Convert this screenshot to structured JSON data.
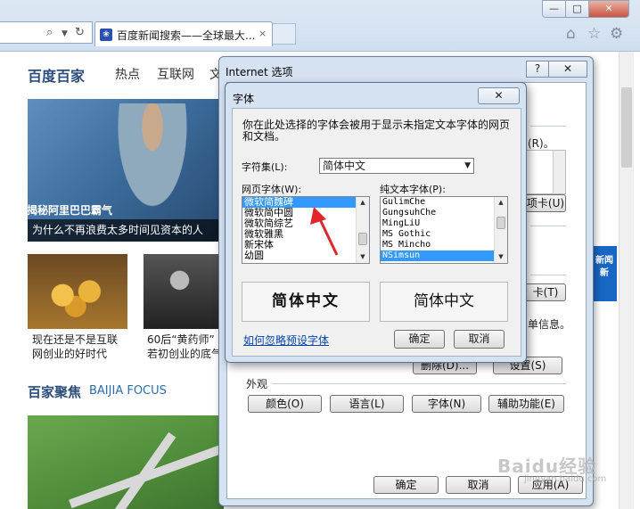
{
  "browser": {
    "tab_title": "百度新闻搜索——全球最大...",
    "tab_close": "×",
    "window_buttons": {
      "minimize": "—",
      "maximize": "□",
      "close": "✕"
    },
    "toolbar_icons": [
      "home-icon",
      "star-icon",
      "gear-icon"
    ]
  },
  "page": {
    "brand": "百度百家",
    "nav": [
      "热点",
      "互联网",
      "文"
    ],
    "hero_overlay_text": "揭秘阿里巴巴霸气",
    "hero_caption": "为什么不再浪费太多时间见资本的人",
    "card1_caption_line1": "现在还是不是互联",
    "card1_caption_line2": "网创业的好时代",
    "card2_caption_line1": "60后“黄药师”",
    "card2_caption_line2": "若初创业的底气",
    "section_title": "百家聚焦",
    "section_subtitle": "BAIJIA FOCUS",
    "ad_text": "新闻 新"
  },
  "internet_options": {
    "title": "Internet 选项",
    "help_label": "?",
    "close_label": "✕",
    "fragment_1": "(R)。",
    "fragment_2": "项卡(U)",
    "fragment_3": "卡(T)",
    "fragment_4": "单信息。",
    "delete_label": "删除(D)...",
    "settings_label": "设置(S)",
    "appearance_label": "外观",
    "colors_label": "颜色(O)",
    "languages_label": "语言(L)",
    "fonts_label": "字体(N)",
    "accessibility_label": "辅助功能(E)",
    "ok_label": "确定",
    "cancel_label": "取消",
    "apply_label": "应用(A)"
  },
  "font_dialog": {
    "title": "字体",
    "close_label": "✕",
    "description": "你在此处选择的字体会被用于显示未指定文本字体的网页和文档。",
    "charset_label": "字符集(L):",
    "charset_value": "简体中文",
    "webpage_font_label": "网页字体(W):",
    "plain_font_label": "纯文本字体(P):",
    "webpage_fonts": [
      "微软简魏碑",
      "微软简中圆",
      "微软简综艺",
      "微软雅黑",
      "新宋体",
      "幼圆"
    ],
    "webpage_selected_index": 0,
    "plain_fonts": [
      "GulimChe",
      "GungsuhChe",
      "MingLiU",
      "MS Gothic",
      "MS Mincho",
      "NSimsun"
    ],
    "plain_selected_index": 5,
    "preview_web": "简体中文",
    "preview_plain": "简体中文",
    "ignore_link": "如何忽略预设字体",
    "ok_label": "确定",
    "cancel_label": "取消"
  },
  "watermark": {
    "main": "Baidu经验",
    "sub": "jingyan.baidu.com"
  }
}
